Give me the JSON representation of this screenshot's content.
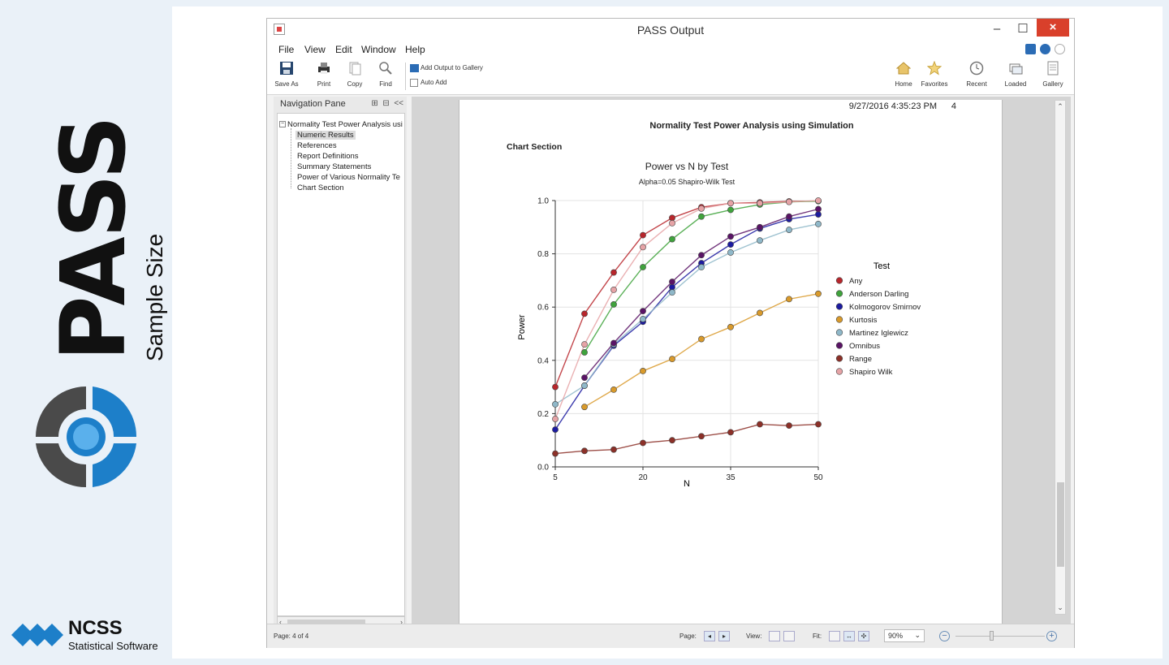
{
  "brand": {
    "product": "PASS",
    "tagline": "Sample Size",
    "company": "NCSS",
    "company_sub": "Statistical Software"
  },
  "window": {
    "title": "PASS Output",
    "min_glyph": "–",
    "max_glyph": "☐",
    "close_glyph": "×"
  },
  "menu": {
    "file": "File",
    "view": "View",
    "edit": "Edit",
    "window": "Window",
    "help": "Help"
  },
  "toolbar": {
    "save_as": "Save As",
    "print": "Print",
    "copy": "Copy",
    "find": "Find",
    "add_output": "Add Output to Gallery",
    "auto_add": "Auto Add",
    "home": "Home",
    "favorites": "Favorites",
    "recent": "Recent",
    "loaded": "Loaded",
    "gallery": "Gallery"
  },
  "nav": {
    "title": "Navigation Pane",
    "collapse": "<<",
    "root": "Normality Test Power Analysis usi",
    "items": [
      "Numeric Results",
      "References",
      "Report Definitions",
      "Summary Statements",
      "Power of Various Normality Te",
      "Chart Section"
    ]
  },
  "document": {
    "timestamp": "9/27/2016 4:35:23 PM",
    "page_number": "4",
    "report_title": "Normality Test Power Analysis using Simulation",
    "section": "Chart Section"
  },
  "chart_data": {
    "type": "line",
    "title": "Power vs N by Test",
    "subtitle": "Alpha=0.05 Shapiro-Wilk Test",
    "xlabel": "N",
    "ylabel": "Power",
    "xlim": [
      5,
      50
    ],
    "ylim": [
      0.0,
      1.0
    ],
    "xticks": [
      "5",
      "20",
      "35",
      "50"
    ],
    "yticks": [
      "0.0",
      "0.2",
      "0.4",
      "0.6",
      "0.8",
      "1.0"
    ],
    "x": [
      5,
      10,
      15,
      20,
      25,
      30,
      35,
      40,
      45,
      50
    ],
    "grid": true,
    "legend_title": "Test",
    "legend_position": "right",
    "series": [
      {
        "name": "Any",
        "color": "#b8262c",
        "values": [
          0.3,
          0.575,
          0.73,
          0.87,
          0.935,
          0.975,
          0.99,
          0.993,
          0.997,
          0.998
        ]
      },
      {
        "name": "Anderson Darling",
        "color": "#3fa33c",
        "values": [
          null,
          0.43,
          0.61,
          0.75,
          0.855,
          0.94,
          0.965,
          0.985,
          0.995,
          0.998
        ]
      },
      {
        "name": "Kolmogorov Smirnov",
        "color": "#1c1ba0",
        "values": [
          0.14,
          0.305,
          0.455,
          0.545,
          0.675,
          0.765,
          0.835,
          0.895,
          0.93,
          0.948
        ]
      },
      {
        "name": "Kurtosis",
        "color": "#d99a2b",
        "values": [
          null,
          0.225,
          0.29,
          0.36,
          0.405,
          0.48,
          0.525,
          0.578,
          0.63,
          0.65
        ]
      },
      {
        "name": "Martinez Iglewicz",
        "color": "#8fb8c9",
        "values": [
          0.235,
          0.305,
          0.46,
          0.555,
          0.655,
          0.75,
          0.805,
          0.85,
          0.89,
          0.912
        ]
      },
      {
        "name": "Omnibus",
        "color": "#5a1466",
        "values": [
          null,
          0.335,
          0.465,
          0.585,
          0.695,
          0.795,
          0.865,
          0.9,
          0.94,
          0.968
        ]
      },
      {
        "name": "Range",
        "color": "#8c3028",
        "values": [
          0.05,
          0.06,
          0.065,
          0.09,
          0.1,
          0.115,
          0.13,
          0.16,
          0.155,
          0.16
        ]
      },
      {
        "name": "Shapiro Wilk",
        "color": "#e6a3a6",
        "values": [
          0.18,
          0.46,
          0.665,
          0.825,
          0.915,
          0.97,
          0.99,
          0.99,
          0.995,
          1.0
        ]
      }
    ]
  },
  "status": {
    "page_info": "Page: 4 of 4",
    "page_label": "Page:",
    "view_label": "View:",
    "fit_label": "Fit:",
    "zoom": "90%"
  }
}
